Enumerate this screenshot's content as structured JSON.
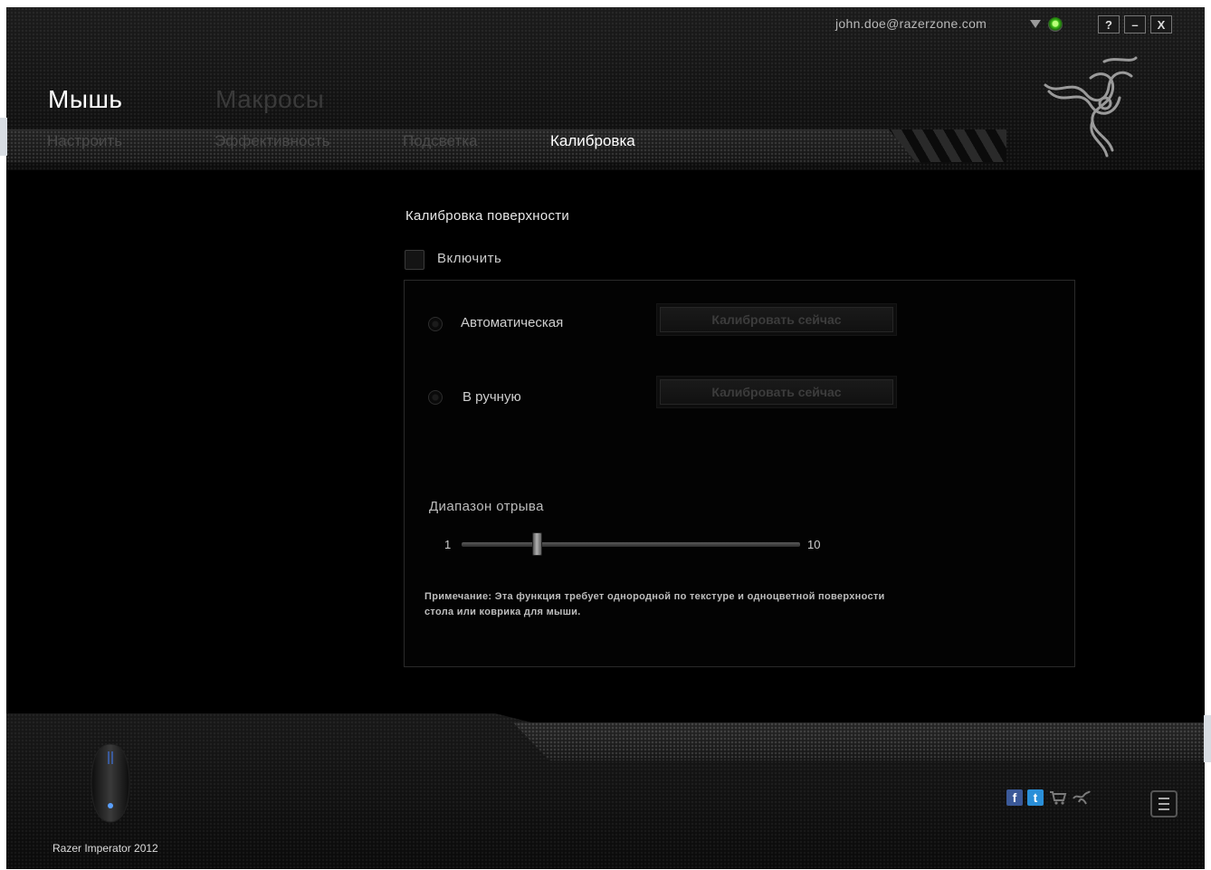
{
  "topbar": {
    "email": "john.doe@razerzone.com",
    "window_buttons": [
      "?",
      "–",
      "X"
    ]
  },
  "main_tabs": [
    {
      "label": "Мышь",
      "active": true
    },
    {
      "label": "Макросы",
      "active": false
    }
  ],
  "sub_tabs": [
    {
      "label": "Настроить",
      "active": false
    },
    {
      "label": "Эффективность",
      "active": false
    },
    {
      "label": "Подсветка",
      "active": false
    },
    {
      "label": "Калибровка",
      "active": true
    }
  ],
  "calibration": {
    "title": "Калибровка поверхности",
    "enable_label": "Включить",
    "enable_checked": false,
    "options": [
      {
        "label": "Автоматическая",
        "button": "Калибровать сейчас"
      },
      {
        "label": "В ручную",
        "button": "Калибровать сейчас"
      }
    ],
    "liftoff": {
      "label": "Диапазон отрыва",
      "min": "1",
      "max": "10",
      "value": 3
    },
    "note": "Примечание: Эта функция требует однородной по текстуре и одноцветной поверхности стола или коврика для мыши."
  },
  "footer": {
    "device_name": "Razer Imperator 2012",
    "social_icons": [
      "facebook-icon",
      "twitter-icon",
      "store-icon",
      "razer-synapse-icon"
    ]
  },
  "colors": {
    "background": "#000000",
    "active_text": "#ffffff",
    "inactive_text": "#4a4a4a",
    "status_green": "#3fbf1a"
  }
}
